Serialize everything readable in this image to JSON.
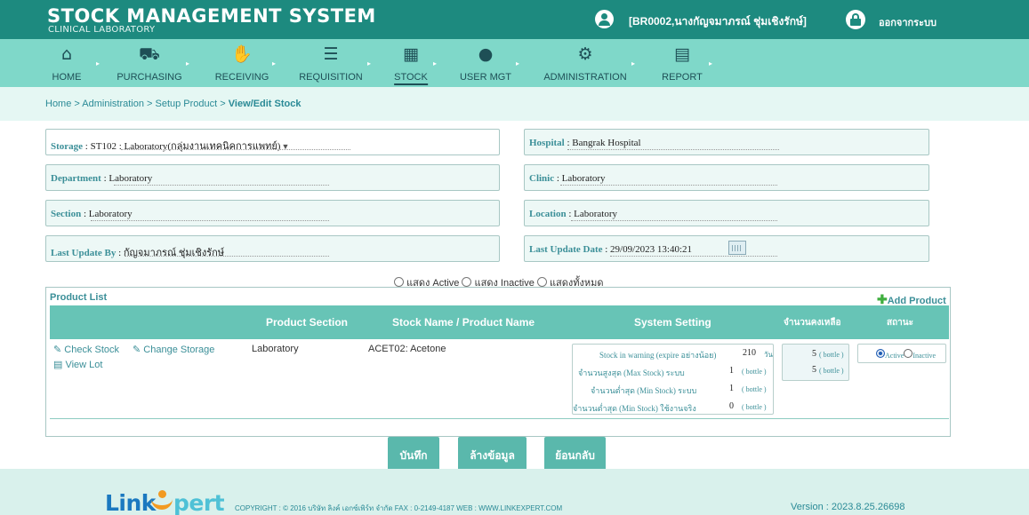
{
  "header": {
    "title": "STOCK MANAGEMENT SYSTEM",
    "subtitle": "CLINICAL LABORATORY",
    "user": "[BR0002,นางกัญจมาภรณ์ ชุ่มเชิงรักษ์]",
    "logout": "ออกจากระบบ",
    "color": "#1d8a7f"
  },
  "nav": {
    "items": [
      {
        "label": "HOME",
        "icon": "home-icon"
      },
      {
        "label": "PURCHASING",
        "icon": "cart-icon"
      },
      {
        "label": "RECEIVING",
        "icon": "handshake-icon"
      },
      {
        "label": "REQUISITION",
        "icon": "checklist-icon"
      },
      {
        "label": "STOCK",
        "icon": "table-icon"
      },
      {
        "label": "USER MGT",
        "icon": "user-icon"
      },
      {
        "label": "ADMINISTRATION",
        "icon": "gear-icon"
      },
      {
        "label": "REPORT",
        "icon": "report-icon"
      }
    ],
    "active": "STOCK",
    "color": "#7fd8c9"
  },
  "breadcrumb": {
    "path": "Home > Administration > Setup Product > ",
    "current": "View/Edit Stock"
  },
  "form": {
    "storage_label": "Storage",
    "storage_value": ": ST102 : Laboratory(กลุ่มงานเทคนิคการแพทย์)",
    "hospital_label": "Hospital",
    "hospital_value": ": Bangrak Hospital",
    "department_label": "Department",
    "department_value": ": Laboratory",
    "clinic_label": "Clinic",
    "clinic_value": ": Laboratory",
    "section_label": "Section",
    "section_value": ": Laboratory",
    "location_label": "Location",
    "location_value": ": Laboratory",
    "last_update_by_label": "Last Update By",
    "last_update_by_value": ": กัญจมาภรณ์ ชุ่มเชิงรักษ์",
    "last_update_date_label": "Last Update Date",
    "last_update_date_value": ": 29/09/2023 13:40:21"
  },
  "filter": {
    "active": "แสดง Active",
    "inactive": "แสดง Inactive",
    "all": "แสดงทั้งหมด"
  },
  "product_list": {
    "title": "Product List",
    "add": "Add Product",
    "headers": {
      "section": "Product Section",
      "name": "Stock Name / Product Name",
      "system": "System Setting",
      "remaining": "จำนวนคงเหลือ",
      "status": "สถานะ"
    },
    "row": {
      "check_stock": "Check Stock",
      "change_storage": "Change Storage",
      "view_lot": "View Lot",
      "section": "Laboratory",
      "name": "ACET02: Acetone",
      "warning_label": "Stock in warning (expire อย่างน้อย)",
      "warning_value": "210",
      "warning_unit": "วัน",
      "max_label": "จำนวนสูงสุด (Max Stock) ระบบ",
      "max_value": "1",
      "max_unit": "( bottle )",
      "min_label": "จำนวนต่ำสุด (Min Stock) ระบบ",
      "min_value": "1",
      "min_unit": "( bottle )",
      "min_real_label": "จำนวนต่ำสุด (Min Stock) ใช้งานจริง",
      "min_real_value": "0",
      "min_real_unit": "( bottle )",
      "qty1": "5",
      "qty1_unit": "( bottle )",
      "qty2": "5",
      "qty2_unit": "( bottle )",
      "status_active": "Active",
      "status_inactive": "Inactive"
    }
  },
  "buttons": {
    "save": "บันทึก",
    "clear": "ล้างข้อมูล",
    "back": "ย้อนกลับ"
  },
  "footer": {
    "logo_link": "Link",
    "logo_pert": "pert",
    "copyright": "COPYRIGHT : © 2016 บริษัท ลิงค์ เอกซ์เพิร์ท จำกัด  FAX : 0-2149-4187  WEB : WWW.LINKEXPERT.COM",
    "version": "Version : 2023.8.25.26698"
  }
}
